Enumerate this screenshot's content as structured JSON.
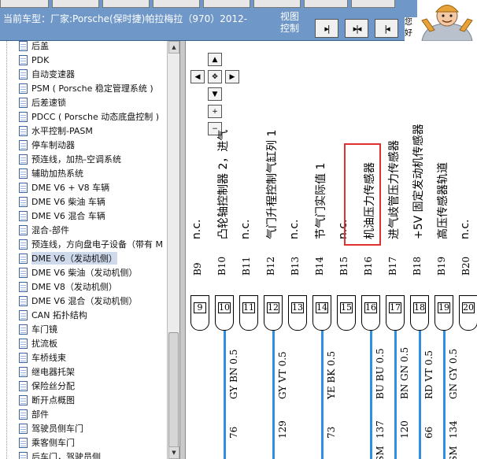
{
  "header": {
    "vehicle_label": "当前车型：厂家:Porsche(保时捷)帕拉梅拉（970）2012-",
    "view_control_label": "视图控制",
    "view_buttons": [
      {
        "icon": "align-right-icon",
        "glyph": "▸|"
      },
      {
        "icon": "expand-horizontal-icon",
        "glyph": "▸|◂"
      },
      {
        "icon": "align-left-icon",
        "glyph": "|◂"
      }
    ],
    "hint_text": "您好"
  },
  "tree": {
    "items": [
      {
        "label": "后盖"
      },
      {
        "label": "PDK"
      },
      {
        "label": "自动变速器"
      },
      {
        "label": "PSM ( Porsche 稳定管理系统 )"
      },
      {
        "label": "后差速锁"
      },
      {
        "label": "PDCC ( Porsche 动态底盘控制 )"
      },
      {
        "label": "水平控制-PASM"
      },
      {
        "label": "停车制动器"
      },
      {
        "label": "预连线，加热-空调系统"
      },
      {
        "label": "辅助加热系统"
      },
      {
        "label": "DME V6 + V8 车辆"
      },
      {
        "label": "DME V6 柴油 车辆"
      },
      {
        "label": "DME V6 混合 车辆"
      },
      {
        "label": "混合-部件"
      },
      {
        "label": "预连线，方向盘电子设备（带有 M"
      },
      {
        "label": "DME V6（发动机侧）",
        "selected": true
      },
      {
        "label": "DME V6 柴油（发动机侧）"
      },
      {
        "label": "DME V8（发动机侧）"
      },
      {
        "label": "DME V6 混合（发动机侧）"
      },
      {
        "label": "CAN 拓扑结构"
      },
      {
        "label": "车门镜"
      },
      {
        "label": "扰流板"
      },
      {
        "label": "车桥线束"
      },
      {
        "label": "继电器托架"
      },
      {
        "label": "保险丝分配"
      },
      {
        "label": "断开点概图"
      },
      {
        "label": "部件"
      },
      {
        "label": "驾驶员侧车门"
      },
      {
        "label": "乘客侧车门"
      },
      {
        "label": "后车门，驾驶员侧"
      }
    ]
  },
  "diagram_nav": [
    {
      "name": "pan-up-icon",
      "glyph": "▲"
    },
    {
      "name": "pan-left-icon",
      "glyph": "◀"
    },
    {
      "name": "pan-center-icon",
      "glyph": "✥"
    },
    {
      "name": "pan-right-icon",
      "glyph": "▶"
    },
    {
      "name": "pan-down-icon",
      "glyph": "▼"
    },
    {
      "name": "zoom-in-icon",
      "glyph": "+"
    },
    {
      "name": "zoom-out-icon",
      "glyph": "−"
    }
  ],
  "pins": [
    {
      "code": "B9",
      "label": "n.c.",
      "num": "9"
    },
    {
      "code": "B10",
      "label": "凸轮轴控制器 2，进气",
      "num": "10",
      "wire": {
        "color": "GY BN 0.5",
        "id": "76"
      }
    },
    {
      "code": "B11",
      "label": "n.c.",
      "num": "11"
    },
    {
      "code": "B12",
      "label": "气门升程控制气缸列 1",
      "num": "12",
      "wire": {
        "color": "GY VT 0.5",
        "id": "129"
      }
    },
    {
      "code": "B13",
      "label": "n.c.",
      "num": "13"
    },
    {
      "code": "B14",
      "label": "节气门实际值 1",
      "num": "14",
      "wire": {
        "color": "YE BK 0.5",
        "id": "73"
      }
    },
    {
      "code": "B15",
      "label": "n.c.",
      "num": "15"
    },
    {
      "code": "B16",
      "label": "机油压力传感器",
      "num": "16",
      "wire": {
        "color": "BU BU 0.5",
        "id": "137",
        "extra": "SM"
      }
    },
    {
      "code": "B17",
      "label": "进气歧管压力传感器",
      "num": "17",
      "wire": {
        "color": "BN GN 0.5",
        "id": "120"
      }
    },
    {
      "code": "B18",
      "label": "+5V 固定发动机传感器",
      "num": "18",
      "wire": {
        "color": "RD VT 0.5",
        "id": "66"
      }
    },
    {
      "code": "B19",
      "label": "高压传感器轨道",
      "num": "19",
      "wire": {
        "color": "GN GY 0.5",
        "id": "134",
        "extra": "SM"
      }
    },
    {
      "code": "B20",
      "label": "n.c.",
      "num": "20"
    }
  ],
  "colors": {
    "header_bg": "#6f98c8",
    "wire": "#2f8fe0",
    "highlight": "#e03030",
    "tree_selected": "#cfd9ec"
  }
}
